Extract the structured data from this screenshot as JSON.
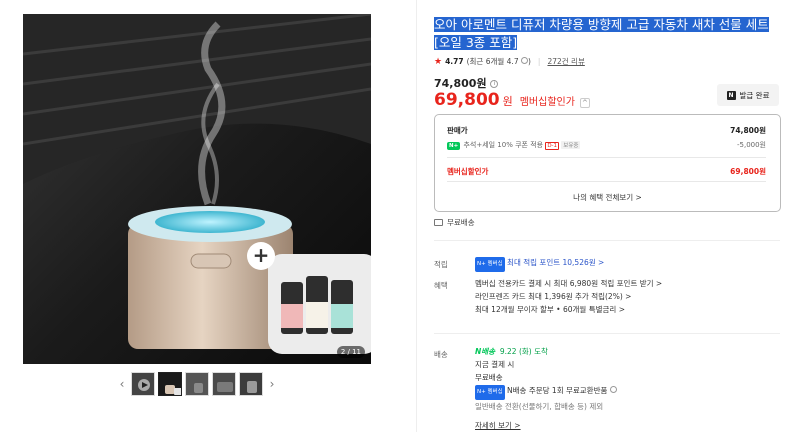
{
  "gallery": {
    "page_indicator": "2 / 11",
    "prev_icon": "chevron-left-icon",
    "next_icon": "chevron-right-icon",
    "thumbnail_count": 5
  },
  "product": {
    "title": "오아 아로멘트 디퓨저 차량용 방향제 고급 자동차 새차 선물 세트 [오일 3종 포함]",
    "rating_score": "4.77",
    "rating_recent": "(최근 6개월 4.7",
    "rating_recent_close": ")",
    "review_count": "272건 리뷰",
    "original_price": "74,800원",
    "sale_price": "69,800",
    "sale_unit": "원",
    "sale_label": "멤버십할인가",
    "coupon_button": "발급 완료"
  },
  "benefits": {
    "sale_price_label": "판매가",
    "sale_price_value": "74,800원",
    "discount_badge": "N+",
    "discount_label": "추석+세일 10% 쿠폰 적용",
    "discount_tag": "D-1",
    "discount_tag2": "보유중",
    "discount_value": "-5,000원",
    "member_label": "멤버십할인가",
    "member_value": "69,800원",
    "more_link": "나의 혜택 전체보기 >"
  },
  "shipping": {
    "free": "무료배송"
  },
  "points": {
    "label": "적립",
    "badge": "N+ 멤버십",
    "text": "최대 적립 포인트 10,526원 >"
  },
  "perks": {
    "label": "혜택",
    "items": [
      "멤버십 전용카드 결제 시 최대 6,980원 적립 포인트 받기 >",
      "라인프렌즈 카드 최대 1,396원 추가 적립(2%) >",
      "최대 12개월 무이자 할부 • 60개월 특별금리 >"
    ]
  },
  "delivery": {
    "label": "배송",
    "n_delivery": "N배송",
    "date": "9.22 (화) 도착",
    "line1": "지금 결제 시",
    "line2": "무료배송",
    "return_badge": "N+ 멤버십",
    "return_text": "N배송 주문당 1회 무료교환반품",
    "exclude": "일반배송 전환(선물하기, 합배송 등) 제외",
    "detail_link": "자세히 보기 >"
  },
  "colors": {
    "accent_red": "#e8241c",
    "naver_green": "#03c75a",
    "highlight_blue": "#2565d0"
  }
}
